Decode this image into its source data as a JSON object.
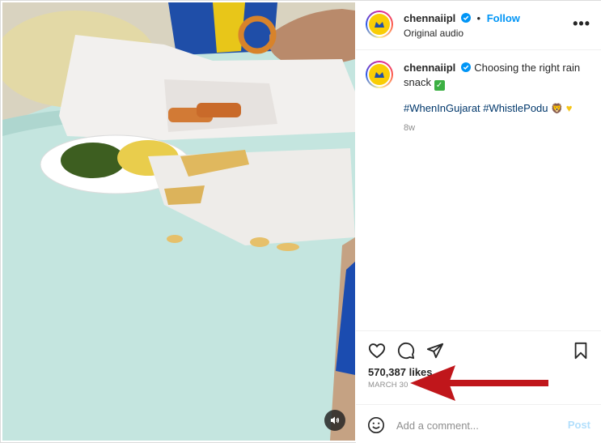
{
  "post": {
    "username": "chennaiipl",
    "follow_label": "Follow",
    "separator": "•",
    "audio_label": "Original audio",
    "more_label": "•••",
    "caption_text": "Choosing the right rain snack",
    "hashtags": [
      "#WhenInGujarat",
      "#WhistlePodu"
    ],
    "age": "8w",
    "likes": "570,387 likes",
    "date": "MARCH 30",
    "comment_placeholder": "Add a comment...",
    "post_label": "Post"
  },
  "colors": {
    "link_blue": "#0095f6",
    "hashtag_blue": "#00376b",
    "annotation_arrow": "#c0161b",
    "table_surface": "#bfe2dc"
  },
  "icons": [
    "verified-icon",
    "more-icon",
    "heart-icon",
    "comment-icon",
    "share-icon",
    "bookmark-icon",
    "emoji-icon",
    "speaker-icon"
  ]
}
